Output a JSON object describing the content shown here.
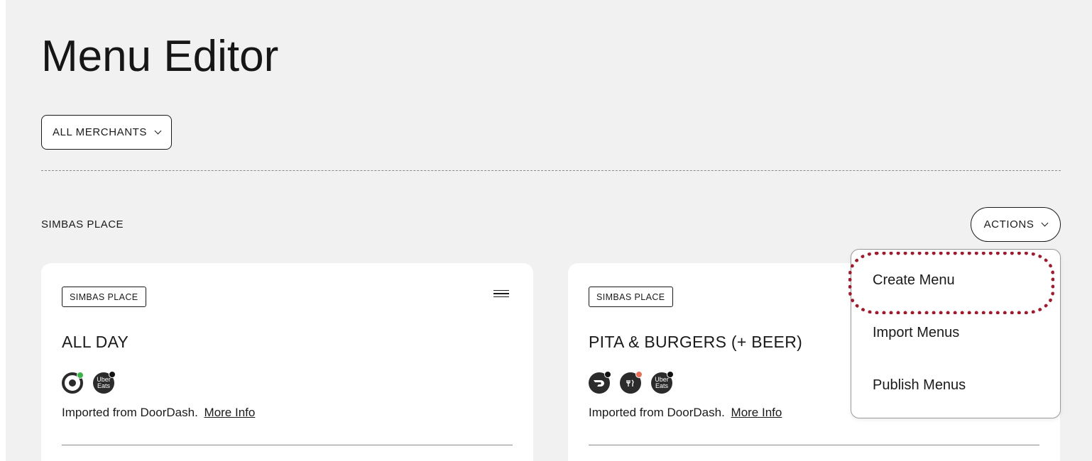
{
  "page": {
    "title": "Menu Editor",
    "merchant_filter": "ALL MERCHANTS",
    "section_label": "SIMBAS PLACE",
    "actions_label": "ACTIONS"
  },
  "actions_menu": {
    "items": [
      {
        "label": "Create Menu",
        "highlighted": true
      },
      {
        "label": "Import Menus"
      },
      {
        "label": "Publish Menus"
      }
    ],
    "highlight_color": "#a01a2e"
  },
  "cards": [
    {
      "badge": "SIMBAS PLACE",
      "title": "ALL DAY",
      "services": [
        {
          "icon": "target-icon",
          "status_color": "#3bb54a"
        },
        {
          "icon": "uber-eats-icon",
          "status_color": "#111111"
        }
      ],
      "info_text": "Imported from DoorDash.",
      "info_link": "More Info"
    },
    {
      "badge": "SIMBAS PLACE",
      "title": "PITA & BURGERS (+ BEER)",
      "services": [
        {
          "icon": "doordash-icon",
          "status_color": "#111111"
        },
        {
          "icon": "grubhub-icon",
          "status_color": "#e8705a"
        },
        {
          "icon": "uber-eats-icon",
          "status_color": "#111111"
        }
      ],
      "info_text": "Imported from DoorDash.",
      "info_link": "More Info"
    }
  ],
  "uber_eats_glyph": {
    "line1": "Uber",
    "line2": "Eats"
  }
}
